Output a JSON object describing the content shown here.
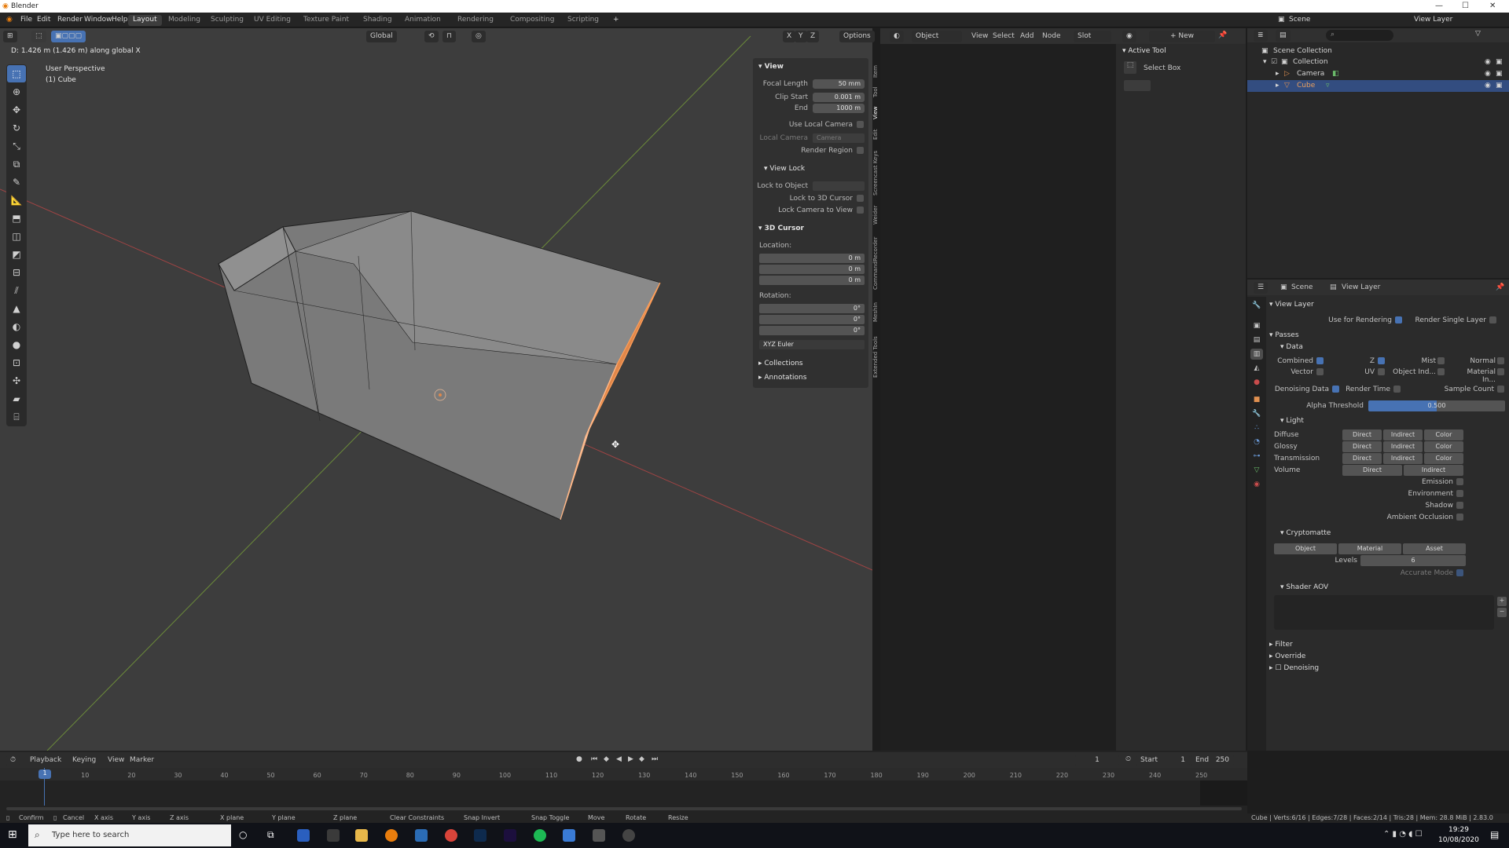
{
  "window": {
    "title": "Blender",
    "minimize": "—",
    "maximize": "☐",
    "close": "✕"
  },
  "menus": [
    "File",
    "Edit",
    "Render",
    "Window",
    "Help"
  ],
  "workspaces": [
    "Layout",
    "Modeling",
    "Sculpting",
    "UV Editing",
    "Texture Paint",
    "Shading",
    "Animation",
    "Rendering",
    "Compositing",
    "Scripting"
  ],
  "active_workspace": "Layout",
  "topright": {
    "scene_label": "Scene",
    "viewlayer_label": "View Layer"
  },
  "viewport": {
    "header_info": "D: 1.426 m (1.426 m) along global X",
    "perspective": "User Perspective",
    "object": "(1) Cube",
    "orientation": "Global",
    "options": "Options",
    "axes": [
      "X",
      "Y",
      "Z"
    ]
  },
  "npanel": {
    "view_title": "View",
    "focal_length_label": "Focal Length",
    "focal_length": "50 mm",
    "clip_start_label": "Clip Start",
    "clip_start": "0.001 m",
    "clip_end_label": "End",
    "clip_end": "1000 m",
    "use_local_camera": "Use Local Camera",
    "local_camera": "Local Camera",
    "camera_placeholder": "Camera",
    "render_region": "Render Region",
    "view_lock_title": "View Lock",
    "lock_to_object": "Lock to Object",
    "lock_to_cursor": "Lock to 3D Cursor",
    "lock_camera_to_view": "Lock Camera to View",
    "cursor_title": "3D Cursor",
    "location_label": "Location:",
    "loc_x": "0 m",
    "loc_y": "0 m",
    "loc_z": "0 m",
    "rotation_label": "Rotation:",
    "rot_x": "0°",
    "rot_y": "0°",
    "rot_z": "0°",
    "rotation_mode": "XYZ Euler",
    "collections": "Collections",
    "annotations": "Annotations",
    "side_tabs": [
      "Item",
      "Tool",
      "View",
      "Edit",
      "Screencast Keys",
      "Weider",
      "CommandRecorder",
      "MeshIn",
      "Extended Tools"
    ]
  },
  "node_editor": {
    "mode": "Object",
    "menus": [
      "View",
      "Select",
      "Add",
      "Node"
    ],
    "slot": "Slot",
    "new_btn": "New"
  },
  "active_tool": {
    "title": "Active Tool",
    "tool": "Select Box"
  },
  "outliner": {
    "root": "Scene Collection",
    "items": [
      {
        "name": "Collection",
        "depth": 1
      },
      {
        "name": "Camera",
        "depth": 2
      },
      {
        "name": "Cube",
        "depth": 2,
        "selected": true
      }
    ]
  },
  "properties": {
    "scene": "Scene",
    "view_layer": "View Layer",
    "section_view_layer": "View Layer",
    "use_for_rendering": "Use for Rendering",
    "render_single_layer": "Render Single Layer",
    "passes": "Passes",
    "data": "Data",
    "combined": "Combined",
    "z": "Z",
    "mist": "Mist",
    "normal": "Normal",
    "vector": "Vector",
    "uv": "UV",
    "object_index": "Object Ind...",
    "material_index": "Material In...",
    "denoising_data": "Denoising Data",
    "render_time": "Render Time",
    "sample_count": "Sample Count",
    "alpha_threshold_label": "Alpha Threshold",
    "alpha_threshold": "0.500",
    "light": "Light",
    "light_rows": [
      {
        "label": "Diffuse",
        "btns": [
          "Direct",
          "Indirect",
          "Color"
        ]
      },
      {
        "label": "Glossy",
        "btns": [
          "Direct",
          "Indirect",
          "Color"
        ]
      },
      {
        "label": "Transmission",
        "btns": [
          "Direct",
          "Indirect",
          "Color"
        ]
      },
      {
        "label": "Volume",
        "btns": [
          "Direct",
          "Indirect"
        ]
      }
    ],
    "emission": "Emission",
    "environment": "Environment",
    "shadow": "Shadow",
    "ambient_occlusion": "Ambient Occlusion",
    "cryptomatte": "Cryptomatte",
    "crypto_btns": [
      "Object",
      "Material",
      "Asset"
    ],
    "levels_label": "Levels",
    "levels": "6",
    "accurate_mode": "Accurate Mode",
    "shader_aov": "Shader AOV",
    "filter": "Filter",
    "override": "Override",
    "denoising": "Denoising"
  },
  "timeline": {
    "menus": [
      "Playback",
      "Keying",
      "View",
      "Marker"
    ],
    "current_frame": "1",
    "start_label": "Start",
    "start": "1",
    "end_label": "End",
    "end": "250",
    "ticks": [
      "1",
      "10",
      "20",
      "30",
      "40",
      "50",
      "60",
      "70",
      "80",
      "90",
      "100",
      "110",
      "120",
      "130",
      "140",
      "150",
      "160",
      "170",
      "180",
      "190",
      "200",
      "210",
      "220",
      "230",
      "240",
      "250"
    ]
  },
  "statusbar": {
    "hints": [
      "Confirm",
      "Cancel",
      "X axis",
      "Y axis",
      "Z axis",
      "X plane",
      "Y plane",
      "Z plane",
      "Clear Constraints",
      "Snap Invert",
      "Snap Toggle",
      "Move",
      "Rotate",
      "Resize"
    ],
    "stats": "Cube | Verts:6/16 | Edges:7/28 | Faces:2/14 | Tris:28 | Mem: 28.8 MiB | 2.83.0"
  },
  "taskbar": {
    "search_placeholder": "Type here to search",
    "time": "19:29",
    "date": "10/08/2020"
  },
  "colors": {
    "accent": "#4772b3",
    "selection_orange": "#e0874a",
    "viewport_bg": "#3d3d3d"
  }
}
